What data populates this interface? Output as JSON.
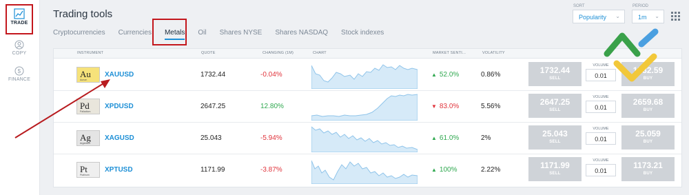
{
  "nav": {
    "trade": "TRADE",
    "copy": "COPY",
    "finance": "FINANCE"
  },
  "header": {
    "title": "Trading tools",
    "tabs": [
      "Cryptocurrencies",
      "Currencies",
      "Metals",
      "Oil",
      "Shares NYSE",
      "Shares NASDAQ",
      "Stock indexes"
    ],
    "active_tab": "Metals",
    "sort_label": "SORT",
    "sort_value": "Popularity",
    "period_label": "PERIOD",
    "period_value": "1m"
  },
  "table": {
    "columns": [
      "INSTRUMENT",
      "QUOTE",
      "CHANGING (1M)",
      "CHART",
      "MARKET SENTI...",
      "VOLATILITY"
    ],
    "volume_label": "VOLUME",
    "sell_label": "SELL",
    "buy_label": "BUY",
    "rows": [
      {
        "metal": "Au",
        "metal_sub": "Aurum",
        "symbol": "XAUUSD",
        "quote": "1732.44",
        "change": "-0.04%",
        "change_dir": "neg",
        "sentiment": "52.0%",
        "sentiment_dir": "up",
        "volatility": "0.86%",
        "sell": "1732.44",
        "volume": "0.01",
        "buy": "1732.59"
      },
      {
        "metal": "Pd",
        "metal_sub": "Palladium",
        "symbol": "XPDUSD",
        "quote": "2647.25",
        "change": "12.80%",
        "change_dir": "pos",
        "sentiment": "83.0%",
        "sentiment_dir": "down",
        "volatility": "5.56%",
        "sell": "2647.25",
        "volume": "0.01",
        "buy": "2659.68"
      },
      {
        "metal": "Ag",
        "metal_sub": "Argentum",
        "symbol": "XAGUSD",
        "quote": "25.043",
        "change": "-5.94%",
        "change_dir": "neg",
        "sentiment": "61.0%",
        "sentiment_dir": "up",
        "volatility": "2%",
        "sell": "25.043",
        "volume": "0.01",
        "buy": "25.059"
      },
      {
        "metal": "Pt",
        "metal_sub": "Platinum",
        "symbol": "XPTUSD",
        "quote": "1171.99",
        "change": "-3.87%",
        "change_dir": "neg",
        "sentiment": "100%",
        "sentiment_dir": "up",
        "volatility": "2.22%",
        "sell": "1171.99",
        "volume": "0.01",
        "buy": "1173.21"
      }
    ]
  },
  "colors": {
    "accent": "#1d8fd6",
    "highlight_box": "#c3161c",
    "negative": "#e0333b",
    "positive": "#2fa84f",
    "sparkline": "#8fc4ea",
    "sparkline_fill": "#d6eaf8",
    "button": "#cfd3d8"
  },
  "icons": [
    "chart-icon",
    "copy-user-icon",
    "finance-dollar-icon",
    "chevron-down-icon",
    "grid-icon",
    "arrow-up-icon",
    "arrow-down-icon"
  ]
}
